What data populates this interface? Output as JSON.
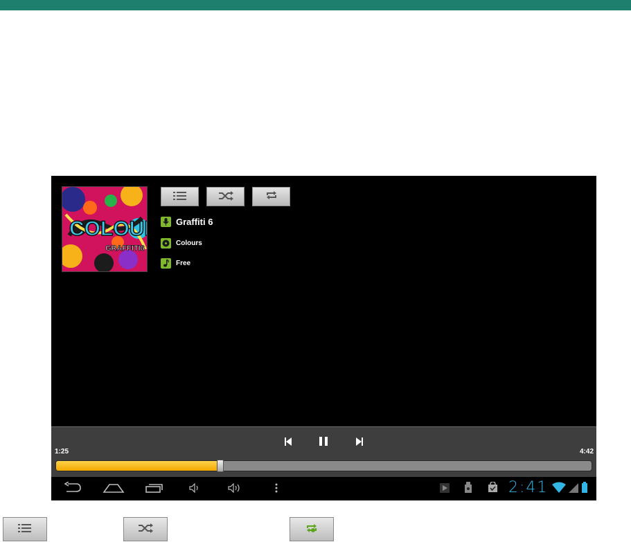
{
  "track": {
    "artist": "Graffiti 6",
    "album": "Colours",
    "song": "Free"
  },
  "album_art": {
    "lettering": "COLOURS GRAFFITI6"
  },
  "player": {
    "elapsed": "1:25",
    "duration": "4:42",
    "progress_fraction": 0.307
  },
  "buttons": {
    "playlist": "playlist-icon",
    "shuffle": "shuffle-icon",
    "repeat": "repeat-icon"
  },
  "status": {
    "clock": "2:41"
  },
  "colors": {
    "accent_green": "#7fb82d",
    "progress": "#f2a800",
    "clock": "#33b5e5",
    "topbar": "#1f7f6e"
  }
}
